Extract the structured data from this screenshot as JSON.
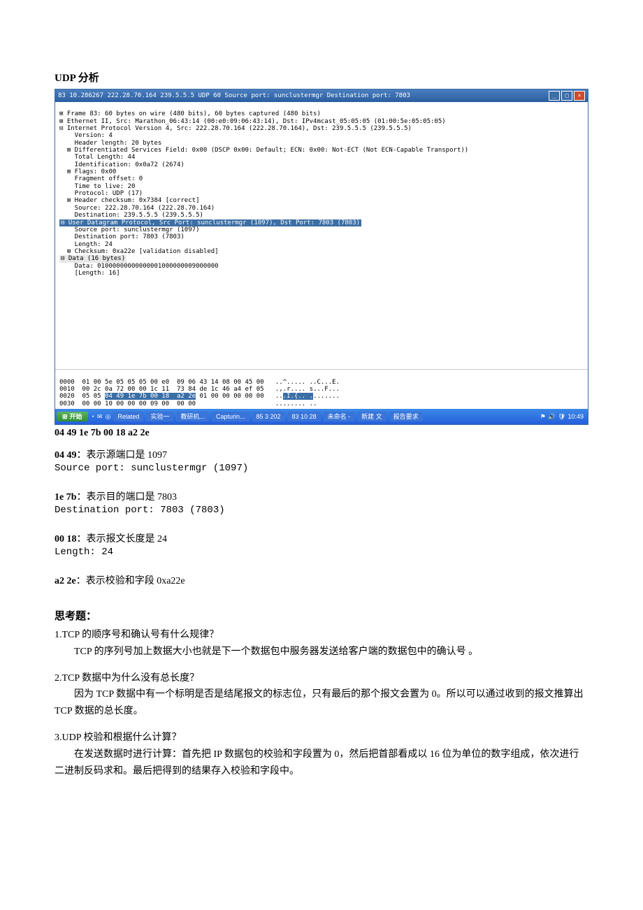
{
  "title": "UDP 分析",
  "wireshark": {
    "titlebar": "83 10.286267 222.28.70.164 239.5.5.5 UDP 60 Source port: sunclustermgr  Destination port: 7803",
    "details": {
      "frame": "⊞ Frame 83: 60 bytes on wire (480 bits), 60 bytes captured (480 bits)",
      "eth": "⊞ Ethernet II, Src: Marathon_06:43:14 (00:e0:09:06:43:14), Dst: IPv4mcast_05:05:05 (01:00:5e:05:05:05)",
      "ip_hdr": "⊟ Internet Protocol Version 4, Src: 222.28.70.164 (222.28.70.164), Dst: 239.5.5.5 (239.5.5.5)",
      "version": "    Version: 4",
      "hlen": "    Header length: 20 bytes",
      "dsf": "  ⊞ Differentiated Services Field: 0x00 (DSCP 0x00: Default; ECN: 0x00: Not-ECT (Not ECN-Capable Transport))",
      "totlen": "    Total Length: 44",
      "ident": "    Identification: 0x0a72 (2674)",
      "flags": "  ⊞ Flags: 0x00",
      "frag": "    Fragment offset: 0",
      "ttl": "    Time to live: 20",
      "proto": "    Protocol: UDP (17)",
      "hchk": "  ⊞ Header checksum: 0x7384 [correct]",
      "src": "    Source: 222.28.70.164 (222.28.70.164)",
      "dst": "    Destination: 239.5.5.5 (239.5.5.5)",
      "udp_hdr": "⊟ User Datagram Protocol, Src Port: sunclustermgr (1097), Dst Port: 7803 (7803)",
      "srcport": "    Source port: sunclustermgr (1097)",
      "dstport": "    Destination port: 7803 (7803)",
      "length": "    Length: 24",
      "chksum": "  ⊞ Checksum: 0xa22e [validation disabled]",
      "data_hdr": "⊟ Data (16 bytes)",
      "data_val": "    Data: 01000000000000001000000009000000",
      "data_len": "    [Length: 16]"
    },
    "hex": {
      "r0": "0000  01 00 5e 05 05 05 00 e0  09 06 43 14 08 00 45 00   ..^..... ..C...E.",
      "r1": "0010  00 2c 0a 72 00 00 1c 11  73 84 de 1c 46 a4 ef 05   .,.r.... s...F...",
      "r2_a": "0020  05 05 ",
      "r2_sel": "04 49 1e 7b 00 18  a2 2e",
      "r2_b": " 01 00 00 00 00 00   ..",
      "r2_sel2": ".I.{.. .",
      "r2_c": ".......",
      "r3": "0030  00 00 10 00 00 00 09 00  00 00                     ........ .."
    },
    "taskbar": {
      "start": "开始",
      "items": [
        "Related",
        "实验一",
        "教研机...",
        "Capturin...",
        "85 3 202",
        "83 10 28",
        "未命名 -",
        "新建 文",
        "报告要求"
      ],
      "tray_time": "10:49"
    }
  },
  "hexline": "04 49 1e 7b 00 18 a2 2e",
  "f1": {
    "label": "04 49",
    "desc": "：表示源端口是 1097",
    "mono": "Source port: sunclustermgr (1097)"
  },
  "f2": {
    "label": "1e 7b",
    "desc": "：表示目的端口是 7803",
    "mono": "Destination port: 7803 (7803)"
  },
  "f3": {
    "label": "00 18",
    "desc": "：表示报文长度是 24",
    "mono": "Length: 24"
  },
  "f4": {
    "label": "a2 2e",
    "desc": "：表示校验和字段 0xa22e"
  },
  "thinking": {
    "title": "思考题：",
    "q1": "1.TCP 的顺序号和确认号有什么规律？",
    "a1": "TCP 的序列号加上数据大小也就是下一个数据包中服务器发送给客户端的数据包中的确认号 。",
    "q2": "2.TCP 数据中为什么没有总长度？",
    "a2": "因为 TCP 数据中有一个标明是否是结尾报文的标志位，只有最后的那个报文会置为 0。所以可以通过收到的报文推算出 TCP 数据的总长度。",
    "q3": "3.UDP 校验和根据什么计算？",
    "a3": "在发送数据时进行计算：首先把 IP 数据包的校验和字段置为 0，然后把首部看成以 16 位为单位的数字组成，依次进行二进制反码求和。最后把得到的结果存入校验和字段中。"
  }
}
